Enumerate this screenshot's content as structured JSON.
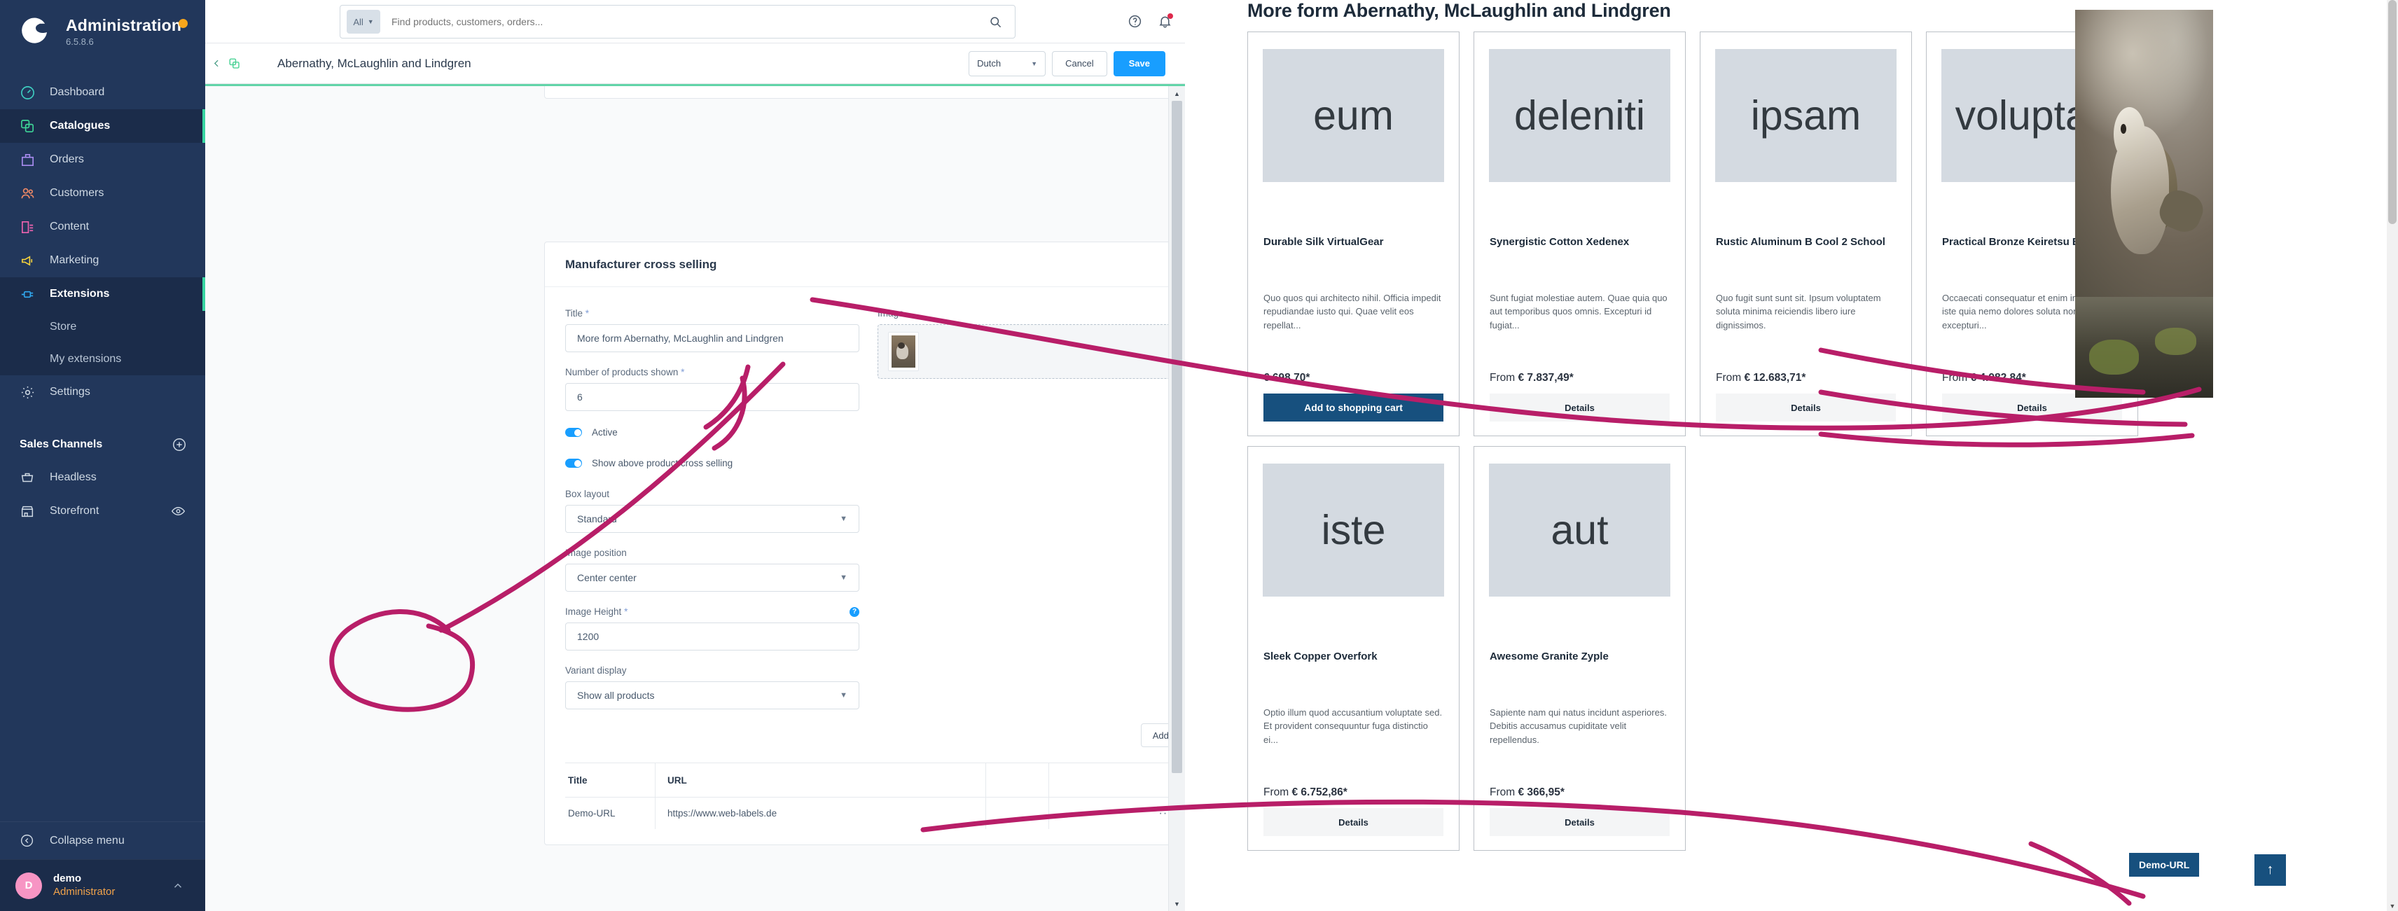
{
  "sidebar": {
    "brand_title": "Administration",
    "brand_version": "6.5.8.6",
    "items": [
      {
        "label": "Dashboard",
        "icon": "dashboard-icon"
      },
      {
        "label": "Catalogues",
        "icon": "catalogues-icon"
      },
      {
        "label": "Orders",
        "icon": "orders-icon"
      },
      {
        "label": "Customers",
        "icon": "customers-icon"
      },
      {
        "label": "Content",
        "icon": "content-icon"
      },
      {
        "label": "Marketing",
        "icon": "marketing-icon"
      },
      {
        "label": "Extensions",
        "icon": "extensions-icon"
      }
    ],
    "sub_items": [
      {
        "label": "Store"
      },
      {
        "label": "My extensions"
      }
    ],
    "settings_label": "Settings",
    "sales_channels_title": "Sales Channels",
    "channels": [
      {
        "label": "Headless",
        "icon": "basket-icon"
      },
      {
        "label": "Storefront",
        "icon": "shop-icon"
      }
    ],
    "collapse_label": "Collapse menu",
    "user_initial": "D",
    "user_name": "demo",
    "user_role": "Administrator"
  },
  "topbar": {
    "search_scope": "All",
    "search_placeholder": "Find products, customers, orders...",
    "search_value": ""
  },
  "smartbar": {
    "title": "Abernathy, McLaughlin and Lindgren",
    "language": "Dutch",
    "cancel_label": "Cancel",
    "save_label": "Save"
  },
  "card": {
    "heading": "Manufacturer cross selling",
    "fields": {
      "title_label": "Title",
      "title_value": "More form Abernathy, McLaughlin and Lindgren",
      "count_label": "Number of products shown",
      "count_value": "6",
      "active_label": "Active",
      "show_above_label": "Show above product cross selling",
      "box_layout_label": "Box layout",
      "box_layout_value": "Standard",
      "image_position_label": "Image position",
      "image_position_value": "Center center",
      "image_height_label": "Image Height",
      "image_height_value": "1200",
      "image_height_help": "?",
      "variant_display_label": "Variant display",
      "variant_display_value": "Show all products",
      "image_label": "Image",
      "image_remove": "×"
    },
    "add_link_label": "Add link",
    "table": {
      "columns": [
        "Title",
        "URL"
      ],
      "rows": [
        {
          "title": "Demo-URL",
          "url": "https://www.web-labels.de",
          "menu": "···"
        }
      ]
    }
  },
  "storefront": {
    "heading": "More form Abernathy, McLaughlin and Lindgren",
    "products": [
      {
        "placeholder": "eum",
        "name": "Durable Silk VirtualGear",
        "description": "Quo quos qui architecto nihil. Officia impedit repudiandae iusto qui. Quae velit eos repellat...",
        "price": "€ 698,70*",
        "price_prefix": "",
        "cta": "Add to shopping cart",
        "cta_type": "primary"
      },
      {
        "placeholder": "deleniti",
        "name": "Synergistic Cotton Xedenex",
        "description": "Sunt fugiat molestiae autem. Quae quia quo aut temporibus quos omnis. Excepturi id fugiat...",
        "price": "€ 7.837,49*",
        "price_prefix": "From",
        "cta": "Details",
        "cta_type": "ghost"
      },
      {
        "placeholder": "ipsam",
        "name": "Rustic Aluminum B Cool 2 School",
        "description": "Quo fugit sunt sunt sit. Ipsum voluptatem soluta minima reiciendis libero iure dignissimos.",
        "price": "€ 12.683,71*",
        "price_prefix": "From",
        "cta": "Details",
        "cta_type": "ghost"
      },
      {
        "placeholder": "voluptas",
        "name": "Practical Bronze Keiretsu Barbie",
        "description": "Occaecati consequatur et enim in dolor. Iste iste quia nemo dolores soluta non. Aut excepturi...",
        "price": "€ 4.982,84*",
        "price_prefix": "From",
        "cta": "Details",
        "cta_type": "ghost"
      },
      {
        "placeholder": "iste",
        "name": "Sleek Copper Overfork",
        "description": "Optio illum quod accusantium voluptate sed. Et provident consequuntur fuga distinctio ei...",
        "price": "€ 6.752,86*",
        "price_prefix": "From",
        "cta": "Details",
        "cta_type": "ghost"
      },
      {
        "placeholder": "aut",
        "name": "Awesome Granite Zyple",
        "description": "Sapiente nam qui natus incidunt asperiores. Debitis accusamus cupiditate velit repellendus.",
        "price": "€ 366,95*",
        "price_prefix": "From",
        "cta": "Details",
        "cta_type": "ghost"
      }
    ],
    "demo_badge": "Demo-URL",
    "scroll_top": "↑"
  },
  "colors": {
    "sidebar_bg": "#22375b",
    "accent_blue": "#189eff",
    "accent_green": "#37d5a2",
    "storefront_blue": "#17507e",
    "annotation_pink": "#b81e68"
  }
}
